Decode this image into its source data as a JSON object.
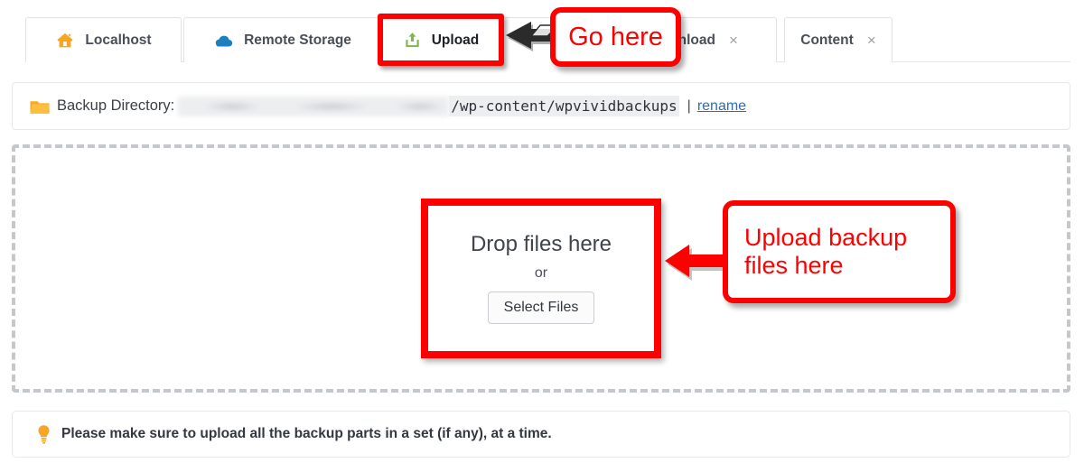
{
  "tabs": [
    {
      "id": "localhost",
      "label": "Localhost",
      "icon": "home-icon",
      "closable": false,
      "active": false
    },
    {
      "id": "remote-storage",
      "label": "Remote Storage",
      "icon": "cloud-icon",
      "closable": false,
      "active": false
    },
    {
      "id": "upload",
      "label": "Upload",
      "icon": "upload-icon",
      "closable": false,
      "active": true
    },
    {
      "id": "download",
      "label": "ownload",
      "icon": "none",
      "closable": true,
      "active": false
    },
    {
      "id": "content",
      "label": "Content",
      "icon": "none",
      "closable": true,
      "active": false
    }
  ],
  "close_glyph": "×",
  "directory": {
    "icon": "folder-icon",
    "label": "Backup Directory:",
    "redacted_path": "",
    "path": "/wp-content/wpvividbackups",
    "separator": "|",
    "rename_link": "rename"
  },
  "dropzone": {
    "title": "Drop files here",
    "or_text": "or",
    "button_label": "Select Files"
  },
  "notice": {
    "icon": "lightbulb-icon",
    "text": "Please make sure to upload all the backup parts in a set (if any), at a time."
  },
  "annotations": [
    {
      "id": "go-here",
      "text": "Go here",
      "color": "#ff0000",
      "arrow": "left-arrow-dark"
    },
    {
      "id": "upload-here-1",
      "text": "Upload backup",
      "color": "#ff0000",
      "arrow": "left-arrow-red"
    },
    {
      "id": "upload-here-2",
      "text": "files here",
      "color": "#ff0000",
      "arrow": "none"
    }
  ],
  "colors": {
    "highlight": "#ff0000",
    "home_icon": "#f5a623",
    "cloud_icon": "#1c7fbe",
    "upload_icon": "#7cb84b",
    "folder_icon": "#f9a825",
    "bulb_icon": "#f5a623",
    "link": "#2a6fb8",
    "dashed_border": "#c4c7cc"
  }
}
